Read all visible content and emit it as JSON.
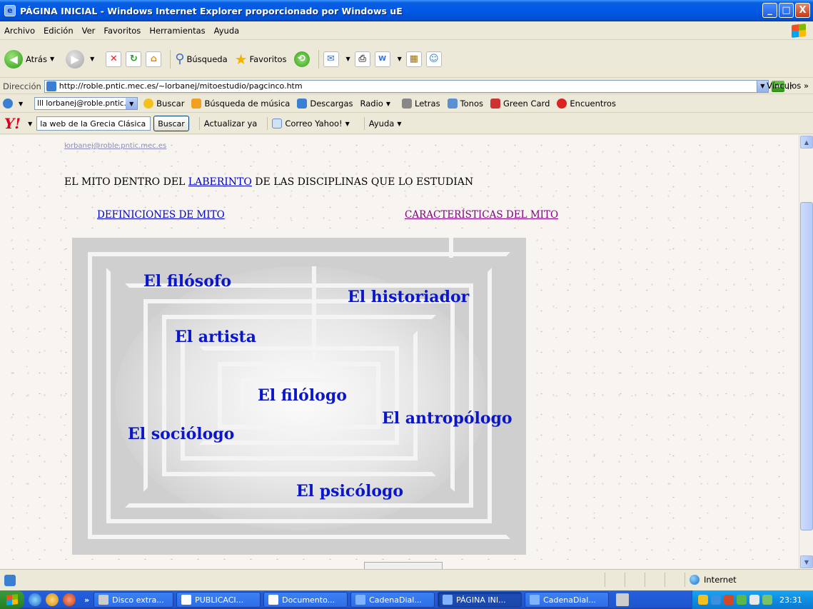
{
  "window": {
    "title": "PÁGINA INICIAL - Windows Internet Explorer proporcionado por Windows uE",
    "btn_min": "_",
    "btn_max": "□",
    "btn_close": "X"
  },
  "menu": [
    "Archivo",
    "Edición",
    "Ver",
    "Favoritos",
    "Herramientas",
    "Ayuda"
  ],
  "toolbar": {
    "back": "Atrás",
    "search": "Búsqueda",
    "favorites": "Favoritos"
  },
  "address": {
    "label": "Dirección",
    "url": "http://roble.pntic.mec.es/~lorbanej/mitoestudio/pagcinco.htm",
    "go": "Ir",
    "links": "Vínculos"
  },
  "linksbar": {
    "combo_value": "lll lorbanej@roble.pntic.me",
    "buscar": "Buscar",
    "musica": "Búsqueda de música",
    "descargas": "Descargas",
    "radio": "Radio",
    "letras": "Letras",
    "tonos": "Tonos",
    "greencard": "Green Card",
    "encuentros": "Encuentros"
  },
  "yahoo": {
    "logo": "Y!",
    "search_value": "la web de la Grecia Clásica",
    "buscar": "Buscar",
    "actualizar": "Actualizar ya",
    "correo": "Correo Yahoo!",
    "ayuda": "Ayuda"
  },
  "page": {
    "email": "lorbanej@roble.pntic.mec.es",
    "heading_pre": "EL MITO DENTRO DEL ",
    "heading_link": "LABERINTO",
    "heading_post": " DE LAS DISCIPLINAS QUE LO ESTUDIAN",
    "link_definiciones": "DEFINICIONES DE MITO",
    "link_caracteristicas": "CARACTERÍSTICAS DEL MITO",
    "maze_labels": {
      "filosofo": "El filósofo",
      "historiador": "El historiador",
      "artista": "El artista",
      "filologo": "El filólogo",
      "antropologo": "El antropólogo",
      "sociologo": "El sociólogo",
      "psicologo": "El psicólogo"
    }
  },
  "status": {
    "zone": "Internet"
  },
  "taskbar": {
    "tasks": [
      "Disco extra...",
      "PUBLICACI...",
      "Documento...",
      "CadenaDial...",
      "PÁGINA INI...",
      "CadenaDial..."
    ],
    "clock": "23:31"
  }
}
